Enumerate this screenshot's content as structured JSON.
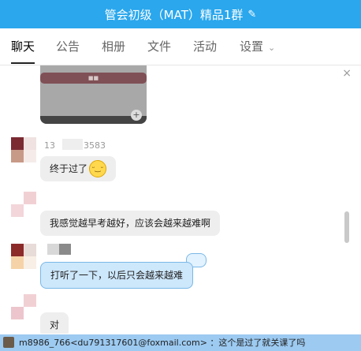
{
  "window": {
    "title": "管会初级（MAT）精品1群",
    "edit_icon": "edit-icon",
    "accent": "#2aa7ed"
  },
  "tabs": [
    {
      "label": "聊天",
      "active": true
    },
    {
      "label": "公告"
    },
    {
      "label": "相册"
    },
    {
      "label": "文件"
    },
    {
      "label": "活动"
    },
    {
      "label": "设置"
    }
  ],
  "chat": {
    "close_icon": "close-icon",
    "image_card": {
      "bar_label": "■■",
      "zoom_icon": "zoom-icon"
    },
    "messages": [
      {
        "nick": "13",
        "nick_tail": "3583",
        "text": "终于过了",
        "emoji": "smirk-emoji"
      },
      {
        "text": "我感觉越早考越好，应该会越来越难啊"
      },
      {
        "text": "打听了一下，以后只会越来越难",
        "style": "self-blue"
      },
      {
        "text": "对"
      }
    ]
  },
  "statusbar": {
    "text": "m8986_766<du791317601@foxmail.com> ：这个是过了就关课了吗",
    "bg": "#9ccaf1"
  }
}
